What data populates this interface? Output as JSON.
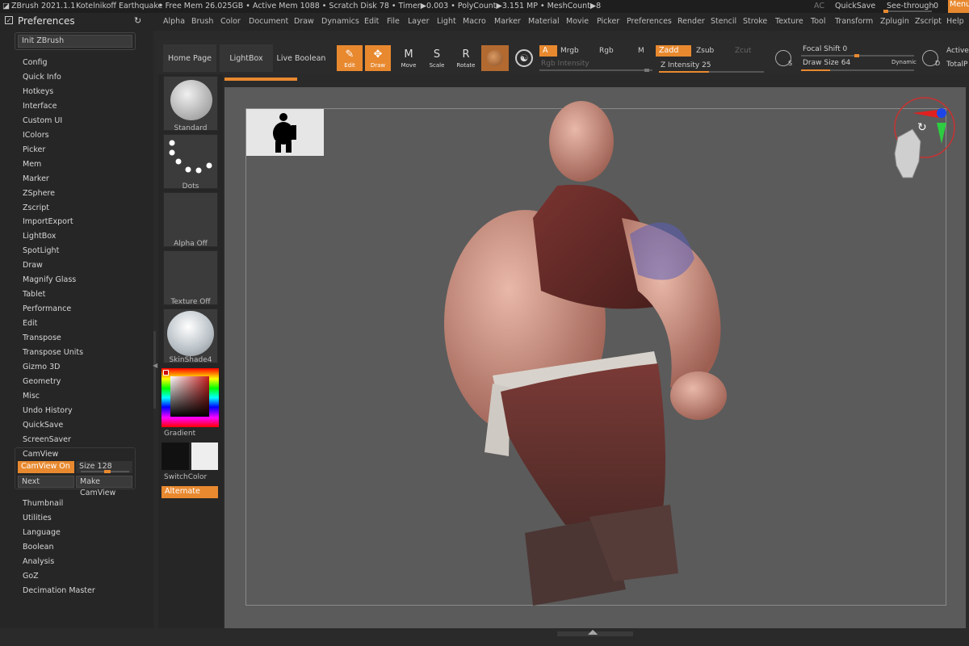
{
  "titlebar": {
    "app": "ZBrush 2021.1.1",
    "project": "Kotelnikoff Earthquake",
    "stats": "• Free Mem 26.025GB • Active Mem 1088 • Scratch Disk 78 • Timer▶0.003 • PolyCount▶3.151 MP • MeshCount▶8",
    "ac": "AC",
    "quicksave": "QuickSave",
    "seethrough": "See-through",
    "seethrough_value": "0",
    "menus": "Menus"
  },
  "palette_title": "Preferences",
  "menu_items": [
    "Alpha",
    "Brush",
    "Color",
    "Document",
    "Draw",
    "Dynamics",
    "Edit",
    "File",
    "Layer",
    "Light",
    "Macro",
    "Marker",
    "Material",
    "Movie",
    "Picker",
    "Preferences",
    "Render",
    "Stencil",
    "Stroke",
    "Texture",
    "Tool",
    "Transform",
    "Zplugin",
    "Zscript",
    "Help"
  ],
  "left_panel": {
    "init_button": "Init ZBrush",
    "items_a": [
      "Config",
      "Quick Info",
      "Hotkeys",
      "Interface",
      "Custom UI",
      "IColors",
      "Picker",
      "Mem",
      "Marker",
      "ZSphere",
      "Zscript",
      "ImportExport",
      "LightBox",
      "SpotLight",
      "Draw",
      "Magnify Glass",
      "Tablet",
      "Performance",
      "Edit",
      "Transpose",
      "Transpose Units",
      "Gizmo 3D",
      "Geometry",
      "Misc",
      "Undo History",
      "QuickSave",
      "ScreenSaver"
    ],
    "camview": {
      "header": "CamView",
      "on_button": "CamView On",
      "size_label": "Size",
      "size_value": "128",
      "size_fraction": 0.55,
      "next_button": "Next",
      "make_button": "Make CamView"
    },
    "items_b": [
      "Thumbnail",
      "Utilities",
      "Language",
      "Boolean",
      "Analysis",
      "GoZ",
      "Decimation Master"
    ]
  },
  "shelf": {
    "tabs": [
      "Home Page",
      "LightBox",
      "Live Boolean"
    ],
    "tools": [
      {
        "label": "Edit",
        "icon": "edit-icon",
        "glyph": "✎",
        "active": true
      },
      {
        "label": "Draw",
        "icon": "draw-icon",
        "glyph": "✥",
        "active": true
      },
      {
        "label": "Move",
        "icon": "move-icon",
        "glyph": "M",
        "active": false
      },
      {
        "label": "Scale",
        "icon": "scale-icon",
        "glyph": "S",
        "active": false
      },
      {
        "label": "Rotate",
        "icon": "rotate-icon",
        "glyph": "R",
        "active": false
      }
    ],
    "a_button": "A",
    "mrgb": "Mrgb",
    "rgb": "Rgb",
    "m": "M",
    "rgb_intensity": "Rgb Intensity",
    "zadd": "Zadd",
    "zsub": "Zsub",
    "zcut": "Zcut",
    "z_intensity_label": "Z Intensity",
    "z_intensity_value": "25",
    "focal_shift_label": "Focal Shift",
    "focal_shift_value": "0",
    "draw_size_label": "Draw Size",
    "draw_size_value": "64",
    "dynamic": "Dynamic",
    "active_points": "Active",
    "total_points": "TotalP",
    "s_letter": "S",
    "d_letter": "D"
  },
  "brush_column": {
    "standard": "Standard",
    "dots": "Dots",
    "alpha_off": "Alpha Off",
    "texture_off": "Texture Off",
    "material": "SkinShade4",
    "gradient": "Gradient",
    "switch_color": "SwitchColor",
    "alternate": "Alternate",
    "main_color": "#111111",
    "secondary_color": "#eeeeee"
  },
  "colors": {
    "accent": "#e8892f",
    "panel": "#262626",
    "viewport": "#5b5b5b"
  }
}
